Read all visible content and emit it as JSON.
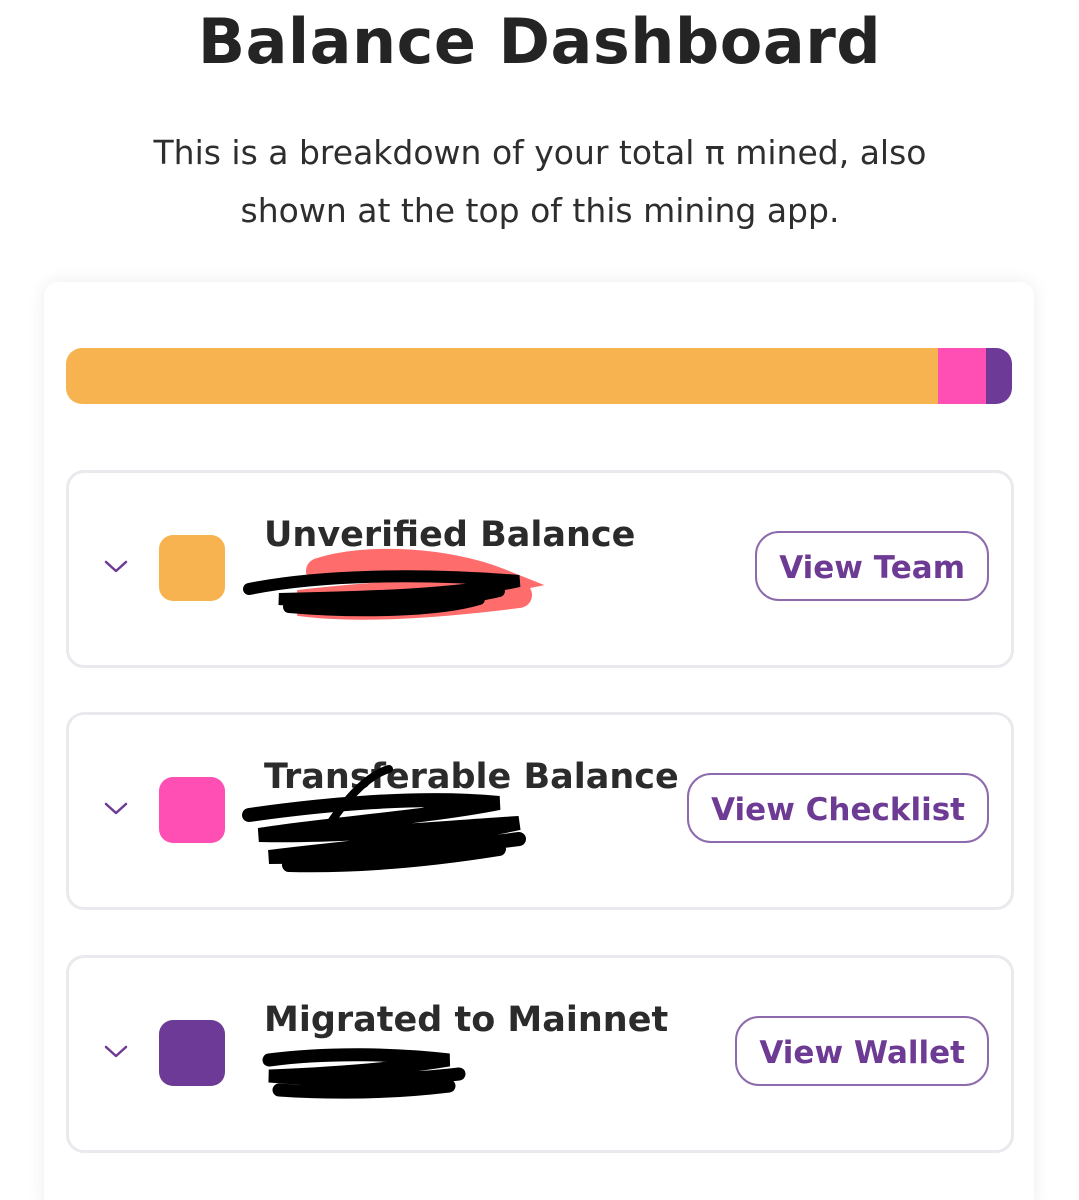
{
  "header": {
    "title": "Balance Dashboard",
    "subtitle": "This is a breakdown of your total π mined, also shown at the top of this mining app."
  },
  "colors": {
    "unverified": "#f7b34f",
    "transferable": "#ff4fb4",
    "migrated": "#6e3a98",
    "accent": "#6d3a94"
  },
  "balance_bar": {
    "unverified_fraction": 0.922,
    "transferable_fraction": 0.05,
    "migrated_fraction": 0.028
  },
  "rows": [
    {
      "label": "Unverified Balance",
      "value": "",
      "button": "View Team",
      "icon": "chevron-down-icon"
    },
    {
      "label": "Transferable Balance",
      "value": "",
      "button": "View Checklist",
      "icon": "chevron-down-icon"
    },
    {
      "label": "Migrated to Mainnet",
      "value": "",
      "button": "View Wallet",
      "icon": "chevron-down-icon"
    }
  ]
}
